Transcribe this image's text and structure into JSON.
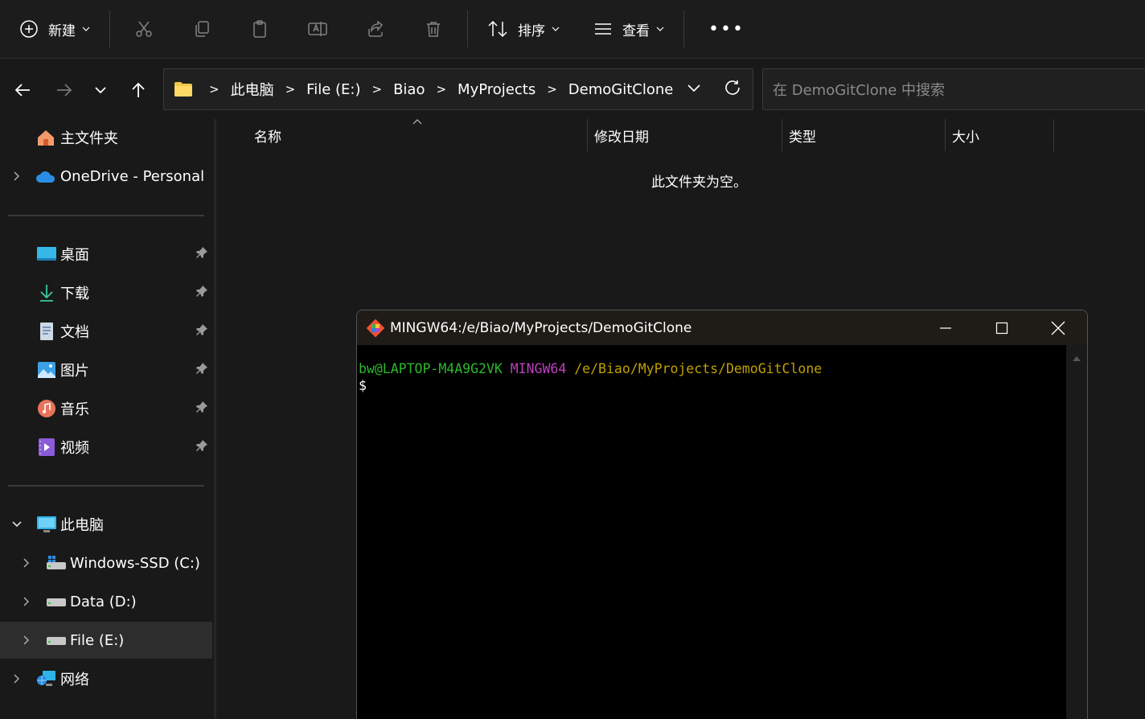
{
  "toolbar": {
    "new_label": "新建",
    "sort_label": "排序",
    "view_label": "查看",
    "more_label": "•••"
  },
  "address": {
    "crumbs": [
      "此电脑",
      "File (E:)",
      "Biao",
      "MyProjects",
      "DemoGitClone"
    ]
  },
  "search": {
    "placeholder": "在 DemoGitClone 中搜索"
  },
  "sidebar": {
    "home": "主文件夹",
    "onedrive": "OneDrive - Personal",
    "quick": [
      {
        "label": "桌面",
        "icon": "desktop-icon"
      },
      {
        "label": "下载",
        "icon": "download-icon"
      },
      {
        "label": "文档",
        "icon": "documents-icon"
      },
      {
        "label": "图片",
        "icon": "pictures-icon"
      },
      {
        "label": "音乐",
        "icon": "music-icon"
      },
      {
        "label": "视频",
        "icon": "videos-icon"
      }
    ],
    "this_pc": "此电脑",
    "drives": [
      {
        "label": "Windows-SSD (C:)"
      },
      {
        "label": "Data (D:)"
      },
      {
        "label": "File (E:)"
      }
    ],
    "network": "网络"
  },
  "content": {
    "columns": [
      "名称",
      "修改日期",
      "类型",
      "大小"
    ],
    "empty_message": "此文件夹为空。"
  },
  "terminal": {
    "title": "MINGW64:/e/Biao/MyProjects/DemoGitClone",
    "user_host": "bw@LAPTOP-M4A9G2VK",
    "env": "MINGW64",
    "path": "/e/Biao/MyProjects/DemoGitClone",
    "prompt": "$"
  },
  "colors": {
    "accent_folder": "#f2c84b",
    "term_green": "#2db82d",
    "term_magenta": "#bf3fbf",
    "term_yellow": "#c0a000"
  }
}
